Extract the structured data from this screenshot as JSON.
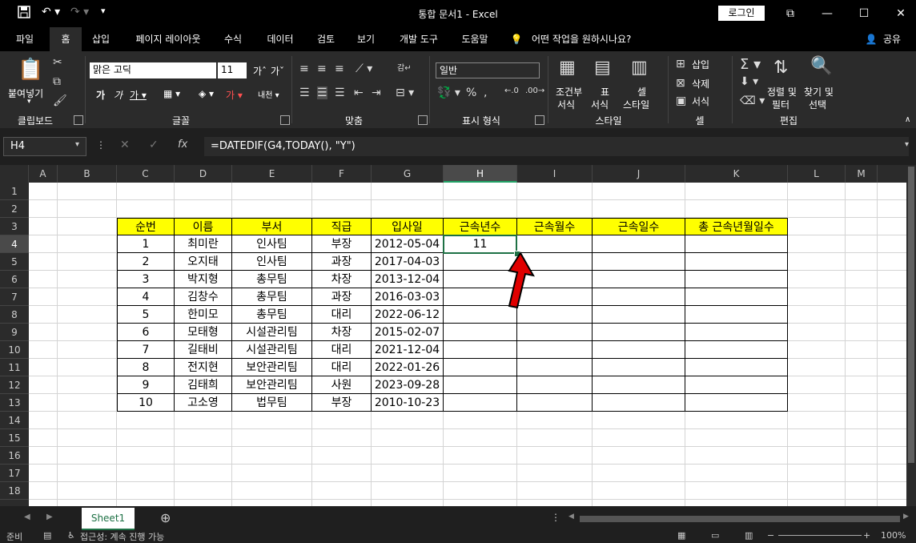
{
  "titlebar": {
    "title": "통합 문서1  -  Excel",
    "login": "로그인",
    "save_icon": "save-icon",
    "undo_icon": "undo-icon",
    "redo_icon": "redo-icon"
  },
  "tabs": [
    "파일",
    "홈",
    "삽입",
    "페이지 레이아웃",
    "수식",
    "데이터",
    "검토",
    "보기",
    "개발 도구",
    "도움말"
  ],
  "tell_me": "어떤 작업을 원하시나요?",
  "share": "공유",
  "ribbon": {
    "paste": "붙여넣기",
    "clipboard": "클립보드",
    "font_name": "맑은 고딕",
    "font_size": "11",
    "font_group": "글꼴",
    "align_group": "맞춤",
    "number_format": "일반",
    "number_group": "표시 형식",
    "cond_format_1": "조건부",
    "cond_format_2": "서식",
    "table_1": "표",
    "table_2": "서식",
    "cell_style_1": "셀",
    "cell_style_2": "스타일",
    "style_group": "스타일",
    "insert": "삽입",
    "delete": "삭제",
    "format": "서식",
    "cells_group": "셀",
    "sort_1": "정렬 및",
    "sort_2": "필터",
    "find_1": "찾기 및",
    "find_2": "선택",
    "edit_group": "편집"
  },
  "formula_bar": {
    "name_box": "H4",
    "formula": "=DATEDIF(G4,TODAY(), \"Y\")"
  },
  "columns": [
    "A",
    "B",
    "C",
    "D",
    "E",
    "F",
    "G",
    "H",
    "I",
    "J",
    "K",
    "L",
    "M"
  ],
  "rows": [
    "1",
    "2",
    "3",
    "4",
    "5",
    "6",
    "7",
    "8",
    "9",
    "10",
    "11",
    "12",
    "13",
    "14",
    "15",
    "16",
    "17",
    "18"
  ],
  "table": {
    "headers": [
      "순번",
      "이름",
      "부서",
      "직급",
      "입사일",
      "근속년수",
      "근속월수",
      "근속일수",
      "총 근속년월일수"
    ],
    "rows": [
      [
        "1",
        "최미란",
        "인사팀",
        "부장",
        "2012-05-04",
        "11",
        "",
        "",
        ""
      ],
      [
        "2",
        "오지태",
        "인사팀",
        "과장",
        "2017-04-03",
        "",
        "",
        "",
        ""
      ],
      [
        "3",
        "박지형",
        "총무팀",
        "차장",
        "2013-12-04",
        "",
        "",
        "",
        ""
      ],
      [
        "4",
        "김창수",
        "총무팀",
        "과장",
        "2016-03-03",
        "",
        "",
        "",
        ""
      ],
      [
        "5",
        "한미모",
        "총무팀",
        "대리",
        "2022-06-12",
        "",
        "",
        "",
        ""
      ],
      [
        "6",
        "모태형",
        "시설관리팀",
        "차장",
        "2015-02-07",
        "",
        "",
        "",
        ""
      ],
      [
        "7",
        "길태비",
        "시설관리팀",
        "대리",
        "2021-12-04",
        "",
        "",
        "",
        ""
      ],
      [
        "8",
        "전지현",
        "보안관리팀",
        "대리",
        "2022-01-26",
        "",
        "",
        "",
        ""
      ],
      [
        "9",
        "김태희",
        "보안관리팀",
        "사원",
        "2023-09-28",
        "",
        "",
        "",
        ""
      ],
      [
        "10",
        "고소영",
        "법무팀",
        "부장",
        "2010-10-23",
        "",
        "",
        "",
        ""
      ]
    ]
  },
  "sheet_tab": "Sheet1",
  "status": {
    "ready": "준비",
    "accessibility": "접근성: 계속 진행 가능",
    "zoom": "100%"
  },
  "colors": {
    "header_fill": "#ffff00",
    "selection": "#1e7145",
    "arrow": "#e00000"
  }
}
